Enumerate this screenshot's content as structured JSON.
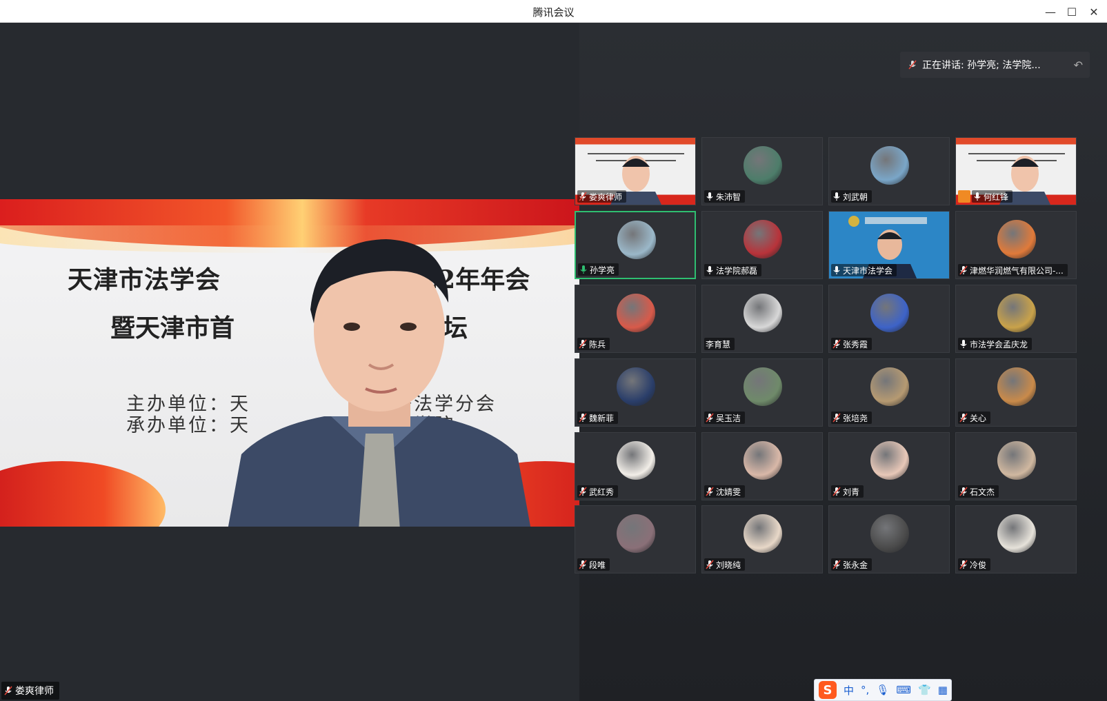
{
  "window": {
    "title": "腾讯会议",
    "controls": {
      "minimize": "—",
      "maximize": "☐",
      "close": "✕"
    }
  },
  "main_video": {
    "slide": {
      "line1_left": "天津市法学会",
      "line1_right": "2022年年会",
      "line2_left": "暨天津市首",
      "line2_right": "观论坛",
      "line3_left": "主办单位：天",
      "line3_right": "经济法学分会",
      "line4_left": "承办单位：天",
      "line4_right": "学法学院"
    },
    "participant_name": "娄爽律师"
  },
  "speaking": {
    "label": "正在讲话: 孙学亮; 法学院..."
  },
  "tiles": [
    {
      "name": "娄爽律师",
      "mic": "muted",
      "kind": "video-slide"
    },
    {
      "name": "朱沛智",
      "mic": "on",
      "kind": "avatar",
      "color": "#4d7d6a"
    },
    {
      "name": "刘武朝",
      "mic": "on",
      "kind": "avatar",
      "color": "#7aa6c8"
    },
    {
      "name": "何红锋",
      "mic": "on",
      "kind": "video-slide",
      "host": true
    },
    {
      "name": "孙学亮",
      "mic": "speaking",
      "kind": "avatar",
      "color": "#9bb8c9",
      "active": true
    },
    {
      "name": "法学院郝磊",
      "mic": "on",
      "kind": "avatar",
      "color": "#b8333a"
    },
    {
      "name": "天津市法学会",
      "mic": "on",
      "kind": "video-blue"
    },
    {
      "name": "津燃华润燃气有限公司-...",
      "mic": "muted",
      "kind": "avatar",
      "color": "#e07a3a"
    },
    {
      "name": "陈兵",
      "mic": "muted",
      "kind": "avatar",
      "color": "#d85a4a"
    },
    {
      "name": "李育慧",
      "mic": "none",
      "kind": "avatar",
      "color": "#d8d8d8"
    },
    {
      "name": "张秀霞",
      "mic": "muted",
      "kind": "avatar",
      "color": "#3d63c8"
    },
    {
      "name": "市法学会孟庆龙",
      "mic": "on",
      "kind": "avatar",
      "color": "#c9a24a"
    },
    {
      "name": "魏新菲",
      "mic": "muted",
      "kind": "avatar",
      "color": "#2a3e6a"
    },
    {
      "name": "吴玉洁",
      "mic": "muted",
      "kind": "avatar",
      "color": "#6f8a6a"
    },
    {
      "name": "张培尧",
      "mic": "muted",
      "kind": "avatar",
      "color": "#b69a72"
    },
    {
      "name": "关心",
      "mic": "muted",
      "kind": "avatar",
      "color": "#c98a4a"
    },
    {
      "name": "武红秀",
      "mic": "muted",
      "kind": "avatar",
      "color": "#f2eee8"
    },
    {
      "name": "沈婧雯",
      "mic": "muted",
      "kind": "avatar",
      "color": "#d9b8a8"
    },
    {
      "name": "刘青",
      "mic": "muted",
      "kind": "avatar",
      "color": "#e8c8b8"
    },
    {
      "name": "石文杰",
      "mic": "muted",
      "kind": "avatar",
      "color": "#d0b8a0"
    },
    {
      "name": "段唯",
      "mic": "muted",
      "kind": "avatar",
      "color": "#8a7078"
    },
    {
      "name": "刘晓纯",
      "mic": "muted",
      "kind": "avatar",
      "color": "#e8d8c8"
    },
    {
      "name": "张永金",
      "mic": "muted",
      "kind": "avatar",
      "color": "#4a4a4a"
    },
    {
      "name": "冷俊",
      "mic": "muted",
      "kind": "avatar",
      "color": "#e6e2da"
    }
  ],
  "ime_toolbar": {
    "logo": "S",
    "mode": "中",
    "punct": "°,",
    "icons": [
      "microphone-icon",
      "keyboard-icon",
      "skin-icon",
      "toolbox-icon"
    ]
  },
  "colors": {
    "active_border": "#2fbf71",
    "muted_mic": "#e0453a",
    "speaking_mic": "#2fbf71",
    "host_badge": "#f08a24"
  }
}
